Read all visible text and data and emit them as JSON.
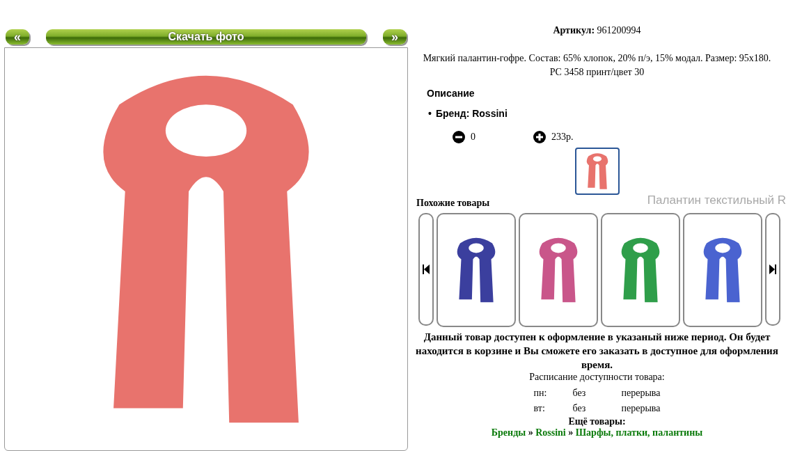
{
  "photo_nav": {
    "prev": "«",
    "download": "Скачать фото",
    "next": "»"
  },
  "article": {
    "label": "Артикул:",
    "value": "961200994"
  },
  "description": "Мягкий палантин-гофре. Состав: 65% хлопок, 20% п/э, 15% модал. Размер: 95x180. PC 3458 принт/цвет 30",
  "details": {
    "heading": "Описание",
    "bullet": "•",
    "items": [
      "Бренд: Rossini"
    ]
  },
  "quantity": {
    "value": "0",
    "price": "233р."
  },
  "thumbnails": [
    {
      "color": "#e8736d",
      "selected": true
    }
  ],
  "tooltip": "Палантин текстильный R",
  "similar": {
    "title": "Похожие товары",
    "items": [
      {
        "color": "#3b3f9e"
      },
      {
        "color": "#c9568a"
      },
      {
        "color": "#2f9e4a"
      },
      {
        "color": "#4a63d0"
      }
    ]
  },
  "notice": "Данный товар доступен к оформление в указаный ниже период. Он будет находится в корзине и Вы сможете его заказать в доступное для оформления время.",
  "schedule": {
    "title": "Расписание доступности товара:",
    "rows": [
      {
        "day": "пн:",
        "from": "без",
        "to": "перерыва"
      },
      {
        "day": "вт:",
        "from": "без",
        "to": "перерыва"
      }
    ]
  },
  "more": {
    "title": "Ещё товары:",
    "breadcrumbs": [
      "Бренды",
      "Rossini",
      "Шарфы, платки, палантины"
    ],
    "separator": "»"
  }
}
